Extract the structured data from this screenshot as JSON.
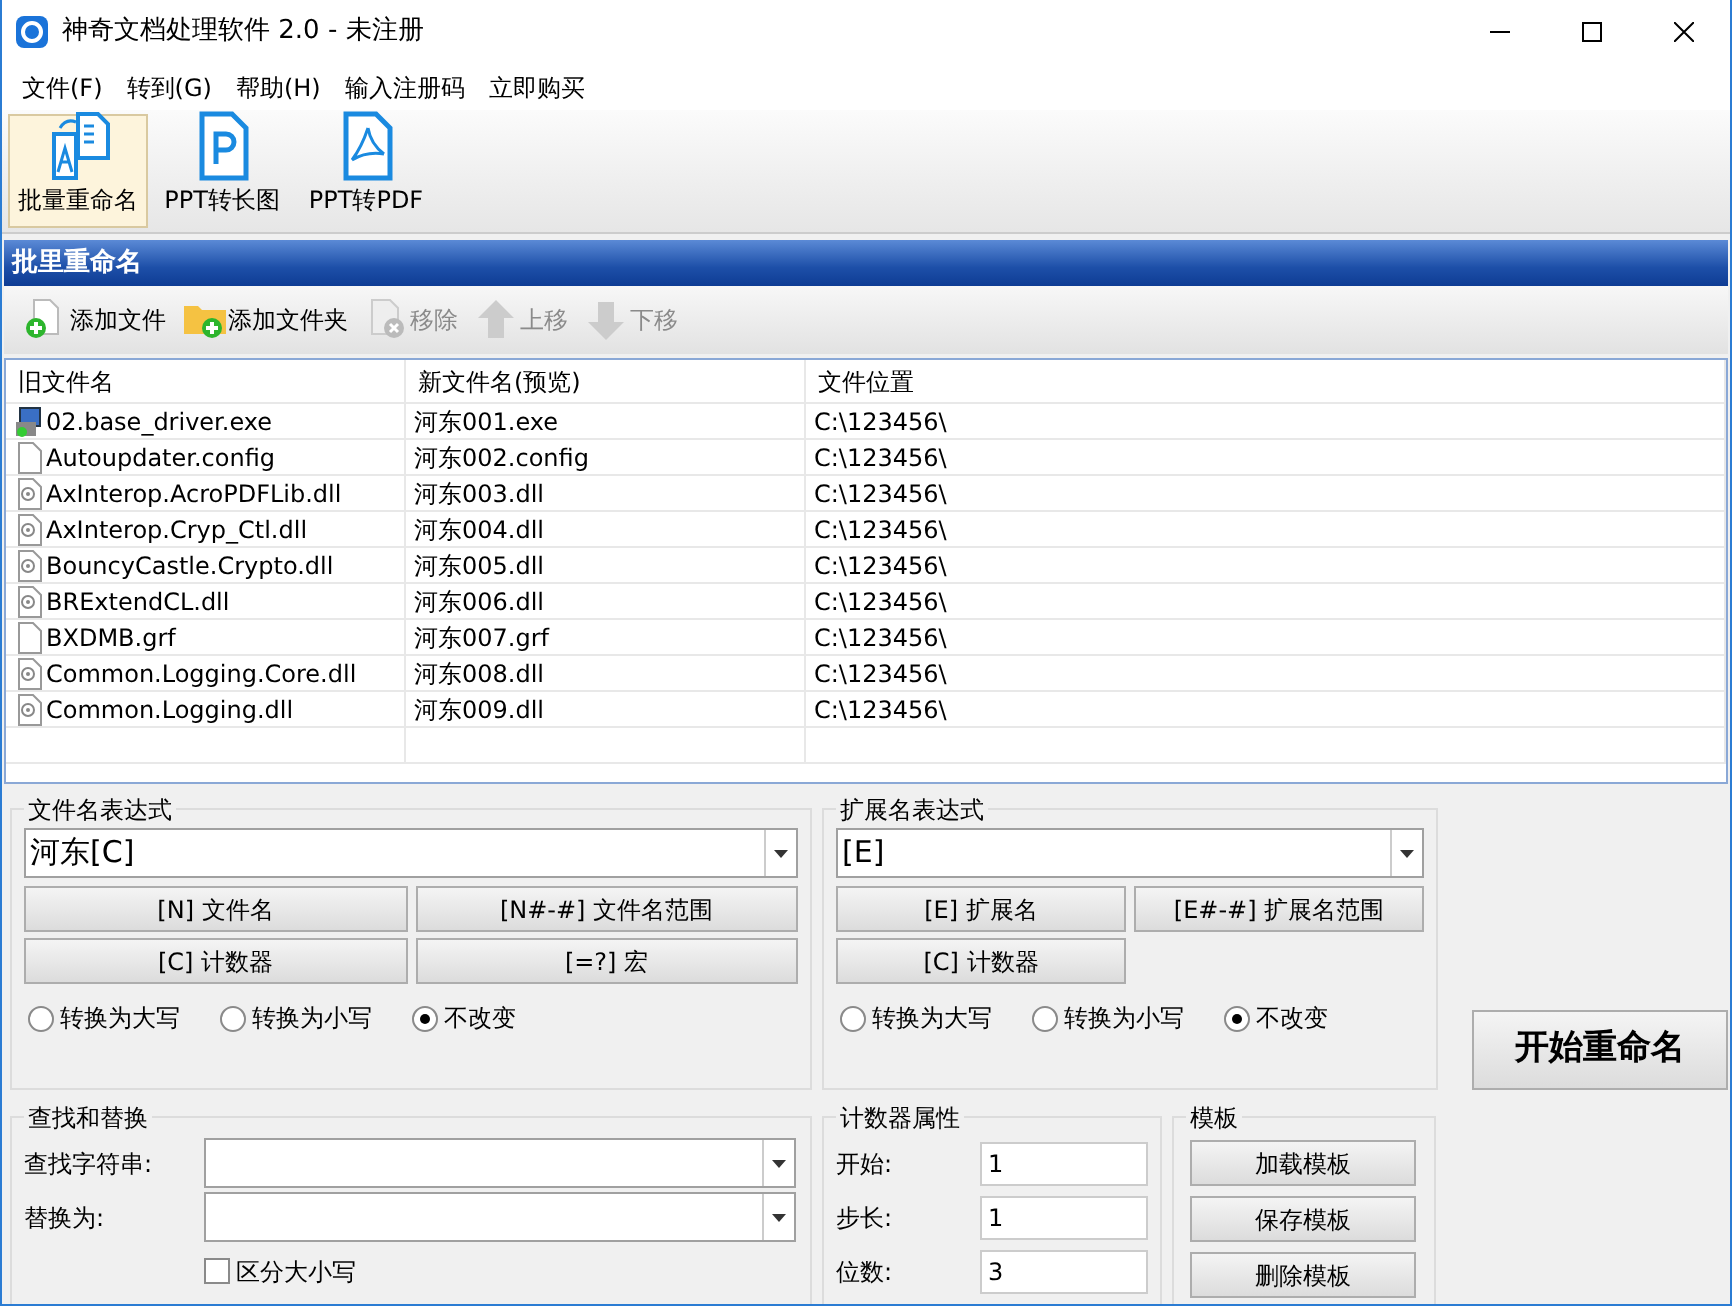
{
  "window": {
    "title": "神奇文档处理软件 2.0 - 未注册"
  },
  "menu": [
    "文件(F)",
    "转到(G)",
    "帮助(H)",
    "输入注册码",
    "立即购买"
  ],
  "toolbar": [
    {
      "label": "批量重命名",
      "kind": "rename",
      "selected": true
    },
    {
      "label": "PPT转长图",
      "kind": "ppt",
      "selected": false
    },
    {
      "label": "PPT转PDF",
      "kind": "pdf",
      "selected": false
    }
  ],
  "panel_title": "批里重命名",
  "actions": [
    {
      "label": "添加文件",
      "kind": "add-file",
      "disabled": false
    },
    {
      "label": "添加文件夹",
      "kind": "add-folder",
      "disabled": false
    },
    {
      "label": "移除",
      "kind": "remove",
      "disabled": true
    },
    {
      "label": "上移",
      "kind": "up",
      "disabled": true
    },
    {
      "label": "下移",
      "kind": "down",
      "disabled": true
    }
  ],
  "file_list": {
    "columns": [
      "旧文件名",
      "新文件名(预览)",
      "文件位置"
    ],
    "rows": [
      {
        "kind": "exe",
        "old_name": "02.base_driver.exe",
        "new_name": "河东001.exe",
        "location": "C:\\123456\\"
      },
      {
        "kind": "file",
        "old_name": "Autoupdater.config",
        "new_name": "河东002.config",
        "location": "C:\\123456\\"
      },
      {
        "kind": "dll",
        "old_name": "AxInterop.AcroPDFLib.dll",
        "new_name": "河东003.dll",
        "location": "C:\\123456\\"
      },
      {
        "kind": "dll",
        "old_name": "AxInterop.Cryp_Ctl.dll",
        "new_name": "河东004.dll",
        "location": "C:\\123456\\"
      },
      {
        "kind": "dll",
        "old_name": "BouncyCastle.Crypto.dll",
        "new_name": "河东005.dll",
        "location": "C:\\123456\\"
      },
      {
        "kind": "dll",
        "old_name": "BRExtendCL.dll",
        "new_name": "河东006.dll",
        "location": "C:\\123456\\"
      },
      {
        "kind": "file",
        "old_name": "BXDMB.grf",
        "new_name": "河东007.grf",
        "location": "C:\\123456\\"
      },
      {
        "kind": "dll",
        "old_name": "Common.Logging.Core.dll",
        "new_name": "河东008.dll",
        "location": "C:\\123456\\"
      },
      {
        "kind": "dll",
        "old_name": "Common.Logging.dll",
        "new_name": "河东009.dll",
        "location": "C:\\123456\\"
      }
    ]
  },
  "filename_expression": {
    "label": "文件名表达式",
    "value": "河东[C]",
    "buttons": [
      "[N] 文件名",
      "[N#-#] 文件名范围",
      "[C] 计数器",
      "[=?] 宏"
    ],
    "case_options": [
      {
        "label": "转换为大写",
        "selected": false
      },
      {
        "label": "转换为小写",
        "selected": false
      },
      {
        "label": "不改变",
        "selected": true
      }
    ]
  },
  "extension_expression": {
    "label": "扩展名表达式",
    "value": "[E]",
    "buttons": [
      "[E] 扩展名",
      "[E#-#] 扩展名范围",
      "[C] 计数器"
    ],
    "case_options": [
      {
        "label": "转换为大写",
        "selected": false
      },
      {
        "label": "转换为小写",
        "selected": false
      },
      {
        "label": "不改变",
        "selected": true
      }
    ]
  },
  "start_button": "开始重命名",
  "find_replace": {
    "label": "查找和替换",
    "find_label": "查找字符串:",
    "replace_label": "替换为:",
    "case_sensitive": {
      "label": "区分大小写",
      "checked": false
    }
  },
  "counter": {
    "label": "计数器属性",
    "fields": [
      {
        "label": "开始:",
        "value": "1"
      },
      {
        "label": "步长:",
        "value": "1"
      },
      {
        "label": "位数:",
        "value": "3"
      }
    ]
  },
  "templates": {
    "label": "模板",
    "buttons": [
      "加载模板",
      "保存模板",
      "删除模板"
    ]
  }
}
